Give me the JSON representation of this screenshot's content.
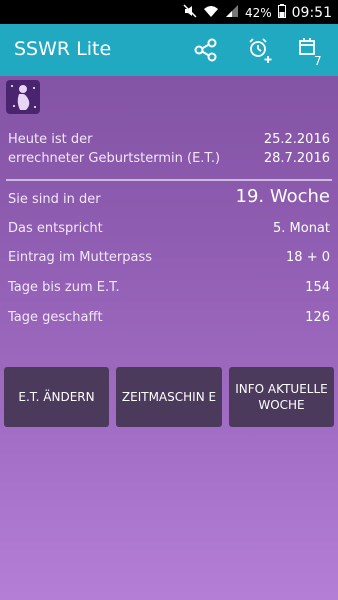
{
  "status_bar": {
    "battery": "42%",
    "time": "09:51"
  },
  "app": {
    "title": "SSWR Lite",
    "calendar_badge": "7"
  },
  "info": {
    "today_label": "Heute ist der",
    "today_value": "25.2.2016",
    "due_label": "errechneter Geburtstermin (E.T.)",
    "due_value": "28.7.2016",
    "week_label": "Sie sind in der",
    "week_value": "19. Woche",
    "month_label": "Das entspricht",
    "month_value": "5. Monat",
    "mutterpass_label": "Eintrag im Mutterpass",
    "mutterpass_value": "18 + 0",
    "days_left_label": "Tage bis zum E.T.",
    "days_left_value": "154",
    "days_done_label": "Tage geschafft",
    "days_done_value": "126"
  },
  "buttons": {
    "change_et": "E.T. ÄNDERN",
    "time_machine": "ZEITMASCHIN E",
    "info_week": "INFO AKTUELLE WOCHE"
  },
  "colors": {
    "appbar": "#22a9c2",
    "button": "#4c3a5c",
    "background_top": "#7e4fa0",
    "background_bottom": "#b47ed7"
  }
}
